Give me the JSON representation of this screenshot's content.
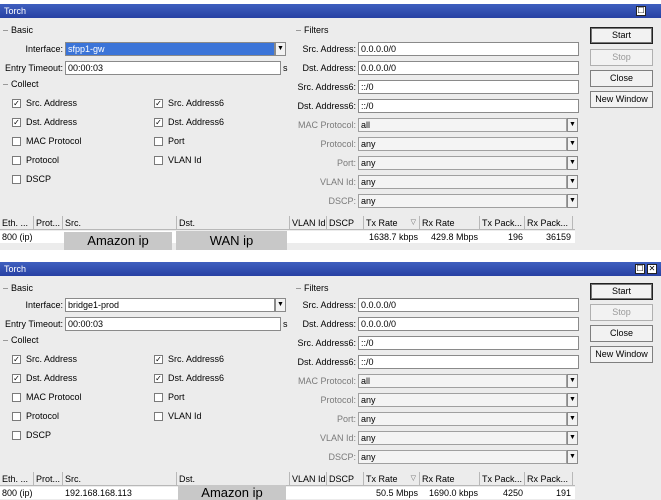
{
  "windows": [
    {
      "title": "Torch",
      "title_buttons": [
        "☐"
      ],
      "basic": {
        "legend": "Basic",
        "interface_label": "Interface:",
        "interface_value": "sfpp1-gw",
        "timeout_label": "Entry Timeout:",
        "timeout_value": "00:00:03",
        "timeout_unit": "s"
      },
      "collect": {
        "legend": "Collect",
        "items": [
          {
            "label": "Src. Address",
            "checked": true
          },
          {
            "label": "Src. Address6",
            "checked": true
          },
          {
            "label": "Dst. Address",
            "checked": true
          },
          {
            "label": "Dst. Address6",
            "checked": true
          },
          {
            "label": "MAC Protocol",
            "checked": false
          },
          {
            "label": "Port",
            "checked": false
          },
          {
            "label": "Protocol",
            "checked": false
          },
          {
            "label": "VLAN Id",
            "checked": false
          },
          {
            "label": "DSCP",
            "checked": false
          }
        ]
      },
      "filters": {
        "legend": "Filters",
        "fields": [
          {
            "label": "Src. Address:",
            "value": "0.0.0.0/0",
            "dropdown": false,
            "disabled": false
          },
          {
            "label": "Dst. Address:",
            "value": "0.0.0.0/0",
            "dropdown": false,
            "disabled": false
          },
          {
            "label": "Src. Address6:",
            "value": "::/0",
            "dropdown": false,
            "disabled": false
          },
          {
            "label": "Dst. Address6:",
            "value": "::/0",
            "dropdown": false,
            "disabled": false
          },
          {
            "label": "MAC Protocol:",
            "value": "all",
            "dropdown": true,
            "disabled": true
          },
          {
            "label": "Protocol:",
            "value": "any",
            "dropdown": true,
            "disabled": true
          },
          {
            "label": "Port:",
            "value": "any",
            "dropdown": true,
            "disabled": true
          },
          {
            "label": "VLAN Id:",
            "value": "any",
            "dropdown": true,
            "disabled": true
          },
          {
            "label": "DSCP:",
            "value": "any",
            "dropdown": true,
            "disabled": true
          }
        ]
      },
      "buttons": {
        "start": "Start",
        "stop": "Stop",
        "close": "Close",
        "new_window": "New Window"
      },
      "columns": [
        "Eth. ...",
        "Prot...",
        "Src.",
        "Dst.",
        "VLAN Id",
        "DSCP",
        "Tx Rate",
        "Rx Rate",
        "Tx Pack...",
        "Rx Pack..."
      ],
      "row": {
        "eth": "800 (ip)",
        "prot": "",
        "src": "",
        "dst": "",
        "vlan": "",
        "dscp": "",
        "tx_rate": "1638.7 kbps",
        "rx_rate": "429.8 Mbps",
        "tx_pack": "196",
        "rx_pack": "36159"
      },
      "overlays": {
        "src": "Amazon ip",
        "dst": "WAN ip"
      }
    },
    {
      "title": "Torch",
      "title_buttons": [
        "☐",
        "✕"
      ],
      "basic": {
        "legend": "Basic",
        "interface_label": "Interface:",
        "interface_value": "bridge1-prod",
        "timeout_label": "Entry Timeout:",
        "timeout_value": "00:00:03",
        "timeout_unit": "s"
      },
      "collect": {
        "legend": "Collect",
        "items": [
          {
            "label": "Src. Address",
            "checked": true
          },
          {
            "label": "Src. Address6",
            "checked": true
          },
          {
            "label": "Dst. Address",
            "checked": true
          },
          {
            "label": "Dst. Address6",
            "checked": true
          },
          {
            "label": "MAC Protocol",
            "checked": false
          },
          {
            "label": "Port",
            "checked": false
          },
          {
            "label": "Protocol",
            "checked": false
          },
          {
            "label": "VLAN Id",
            "checked": false
          },
          {
            "label": "DSCP",
            "checked": false
          }
        ]
      },
      "filters": {
        "legend": "Filters",
        "fields": [
          {
            "label": "Src. Address:",
            "value": "0.0.0.0/0",
            "dropdown": false,
            "disabled": false
          },
          {
            "label": "Dst. Address:",
            "value": "0.0.0.0/0",
            "dropdown": false,
            "disabled": false
          },
          {
            "label": "Src. Address6:",
            "value": "::/0",
            "dropdown": false,
            "disabled": false
          },
          {
            "label": "Dst. Address6:",
            "value": "::/0",
            "dropdown": false,
            "disabled": false
          },
          {
            "label": "MAC Protocol:",
            "value": "all",
            "dropdown": true,
            "disabled": true
          },
          {
            "label": "Protocol:",
            "value": "any",
            "dropdown": true,
            "disabled": true
          },
          {
            "label": "Port:",
            "value": "any",
            "dropdown": true,
            "disabled": true
          },
          {
            "label": "VLAN Id:",
            "value": "any",
            "dropdown": true,
            "disabled": true
          },
          {
            "label": "DSCP:",
            "value": "any",
            "dropdown": true,
            "disabled": true
          }
        ]
      },
      "buttons": {
        "start": "Start",
        "stop": "Stop",
        "close": "Close",
        "new_window": "New Window"
      },
      "columns": [
        "Eth. ...",
        "Prot...",
        "Src.",
        "Dst.",
        "VLAN Id",
        "DSCP",
        "Tx Rate",
        "Rx Rate",
        "Tx Pack...",
        "Rx Pack..."
      ],
      "row": {
        "eth": "800 (ip)",
        "prot": "",
        "src": "192.168.168.113",
        "dst": "",
        "vlan": "",
        "dscp": "",
        "tx_rate": "50.5 Mbps",
        "rx_rate": "1690.0 kbps",
        "tx_pack": "4250",
        "rx_pack": "191"
      },
      "overlays": {
        "src": "",
        "dst": "Amazon ip"
      }
    }
  ]
}
